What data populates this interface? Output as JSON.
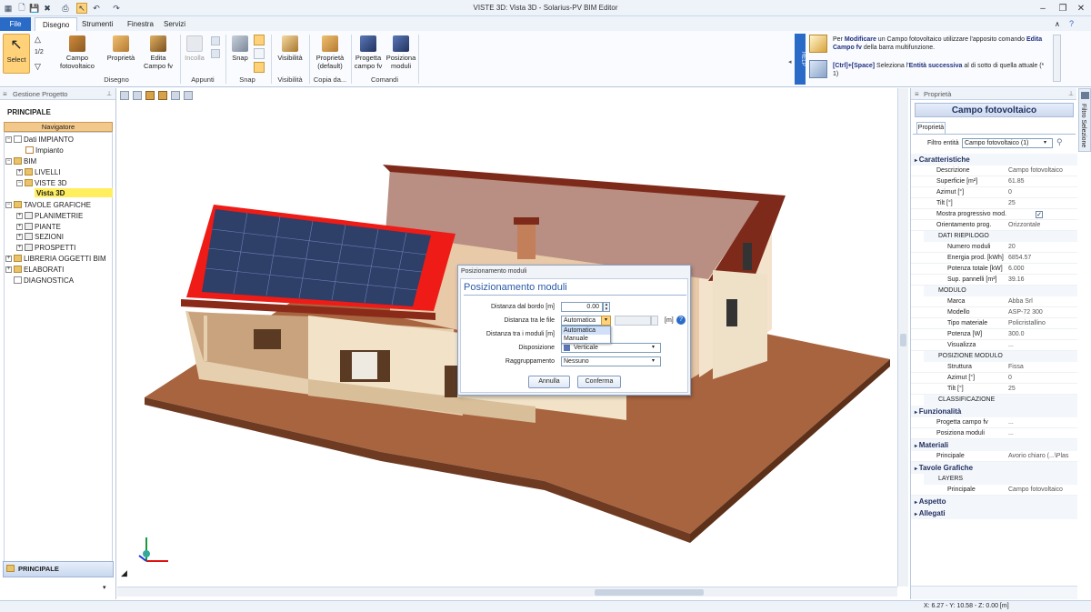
{
  "window": {
    "title": "VISTE 3D: Vista 3D - Solarius-PV BIM Editor"
  },
  "tabs": [
    "File",
    "Disegno",
    "Strumenti",
    "Finestra",
    "Servizi"
  ],
  "ribbon": {
    "select": "Select",
    "half": "1/2",
    "campo": "Campo\nfotovoltaico",
    "proprieta": "Proprietà",
    "edita": "Edita\nCampo fv",
    "incolla": "Incolla",
    "snap": "Snap",
    "visibilita": "Visibilità",
    "prop_default": "Proprietà\n(default)",
    "progetta": "Progetta\ncampo fv",
    "posiziona": "Posiziona\nmoduli",
    "groups": {
      "disegno": "Disegno",
      "appunti": "Appunti",
      "snap": "Snap",
      "visibilita": "Visibilità",
      "copia": "Copia da...",
      "comandi": "Comandi"
    },
    "help_label": "HELP",
    "help1_pre": "Per ",
    "help1_b1": "Modificare",
    "help1_mid": " un Campo fotovoltaico utilizzare l'apposito comando ",
    "help1_b2": "Edita Campo fv",
    "help1_post": " della barra multifunzione.",
    "help2_b1": "[Ctrl]+[Space]",
    "help2_mid": " Seleziona l'",
    "help2_b2": "Entità successiva",
    "help2_post": " al di sotto di quella attuale (* 1)"
  },
  "left": {
    "panel_title": "Gestione Progetto",
    "principale": "PRINCIPALE",
    "navigatore": "Navigatore",
    "bottom": "PRINCIPALE",
    "tree": [
      "Dati IMPIANTO",
      "Impianto",
      "BIM",
      "LIVELLI",
      "VISTE 3D",
      "Vista 3D",
      "TAVOLE GRAFICHE",
      "PLANIMETRIE",
      "PIANTE",
      "SEZIONI",
      "PROSPETTI",
      "LIBRERIA OGGETTI BIM",
      "ELABORATI",
      "DIAGNOSTICA"
    ]
  },
  "dialog": {
    "window_title": "Posizionamento moduli",
    "heading": "Posizionamento moduli",
    "l_bordo": "Distanza dal bordo [m]",
    "v_bordo": "0.00",
    "l_file": "Distanza tra le file",
    "v_file": "Automatica",
    "unit_m": "[m]",
    "l_moduli": "Distanza tra i moduli [m]",
    "options": [
      "Automatica",
      "Manuale"
    ],
    "l_disp": "Disposizione",
    "v_disp": "Verticale",
    "l_rag": "Raggruppamento",
    "v_rag": "Nessuno",
    "annulla": "Annulla",
    "conferma": "Conferma"
  },
  "right": {
    "panel_title": "Proprietà",
    "header": "Campo fotovoltaico",
    "tab": "Proprietà",
    "filtro_label": "Filtro entità",
    "filtro_value": "Campo fotovoltaico (1)",
    "side_tab": "Filtro Selezione",
    "caratteristiche": "Caratteristiche",
    "props": [
      [
        "Descrizione",
        "Campo fotovoltaico"
      ],
      [
        "Superficie [m²]",
        "61.85"
      ],
      [
        "Azimut [°]",
        "0"
      ],
      [
        "Tilt [°]",
        "25"
      ],
      [
        "Mostra progressivo mod.",
        ""
      ],
      [
        "Orientamento prog.",
        "Orizzontale"
      ]
    ],
    "riepilogo": "DATI RIEPILOGO",
    "riep": [
      [
        "Numero moduli",
        "20"
      ],
      [
        "Energia prod. [kWh]",
        "6854.57"
      ],
      [
        "Potenza totale [kW]",
        "6.000"
      ],
      [
        "Sup. pannelli [m²]",
        "39.16"
      ]
    ],
    "modulo": "MODULO",
    "mod": [
      [
        "Marca",
        "Abba Srl"
      ],
      [
        "Modello",
        "ASP-72 300"
      ],
      [
        "Tipo materiale",
        "Policristallino"
      ],
      [
        "Potenza [W]",
        "300.0"
      ],
      [
        "Visualizza",
        "..."
      ]
    ],
    "posizione": "POSIZIONE MODULO",
    "pos": [
      [
        "Struttura",
        "Fissa"
      ],
      [
        "Azimut [°]",
        "0"
      ],
      [
        "Tilt [°]",
        "25"
      ]
    ],
    "classificazione": "CLASSIFICAZIONE",
    "funzionalita": "Funzionalità",
    "funz": [
      [
        "Progetta campo fv",
        "..."
      ],
      [
        "Posiziona moduli",
        "..."
      ]
    ],
    "materiali": "Materiali",
    "mat": [
      [
        "Principale",
        "Avorio chiaro (...\\Plas"
      ]
    ],
    "tavole": "Tavole Grafiche",
    "layers": "LAYERS",
    "lay": [
      [
        "Principale",
        "Campo fotovoltaico"
      ]
    ],
    "aspetto": "Aspetto",
    "allegati": "Allegati"
  },
  "status": {
    "coords": "X: 6.27 - Y: 10.58 - Z: 0.00 [m]"
  }
}
